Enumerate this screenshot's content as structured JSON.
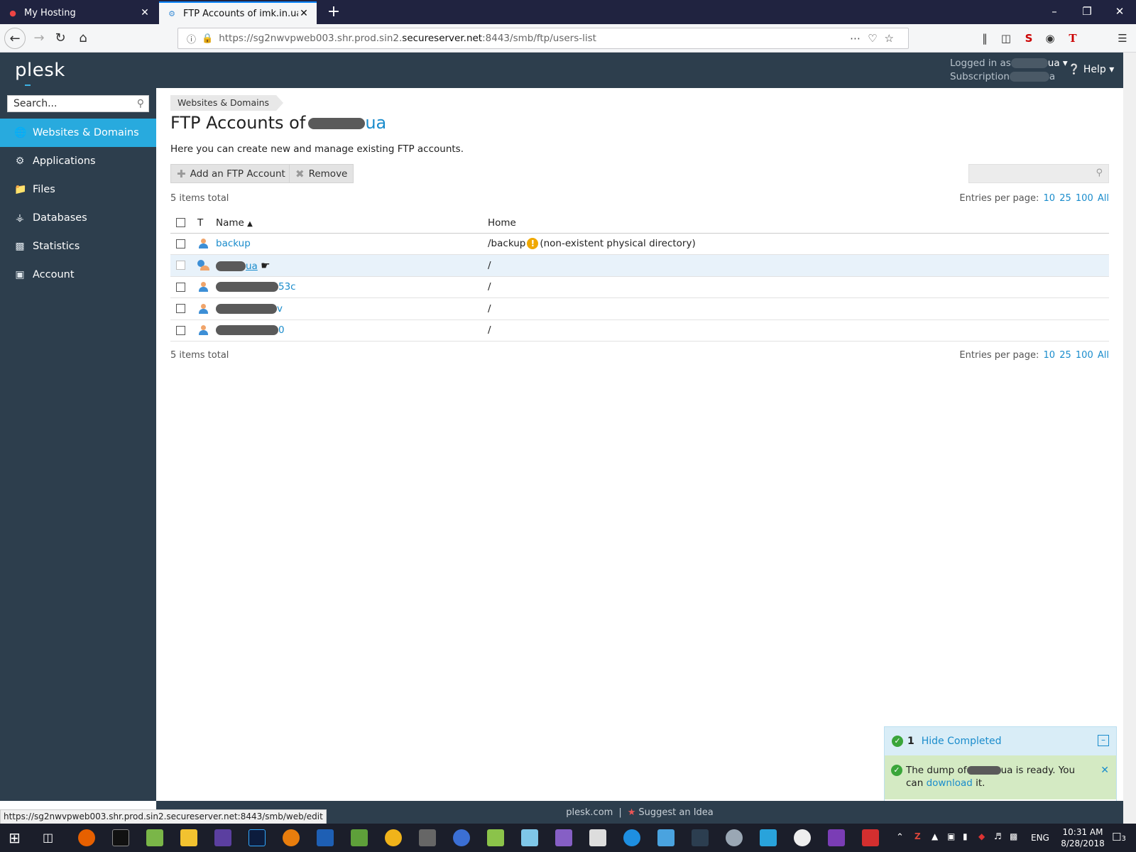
{
  "browser": {
    "tabs": [
      {
        "title": "My Hosting",
        "active": false
      },
      {
        "title": "FTP Accounts of imk.in.ua - Ple",
        "active": true
      }
    ],
    "url": {
      "prefix": "https://sg2nwvpweb003.shr.prod.sin2.",
      "domain": "secureserver.net",
      "suffix": ":8443/smb/ftp/users-list"
    },
    "status_url": "https://sg2nwvpweb003.shr.prod.sin2.secureserver.net:8443/smb/web/edit"
  },
  "header": {
    "logo": "plesk",
    "logged_in_prefix": "Logged in as",
    "logged_in_suffix": "ua",
    "subscription_prefix": "Subscription",
    "subscription_suffix": "a",
    "help_label": "Help"
  },
  "sidebar": {
    "search_placeholder": "Search...",
    "items": [
      {
        "label": "Websites & Domains",
        "icon": "globe-icon",
        "active": true
      },
      {
        "label": "Applications",
        "icon": "gear-icon",
        "active": false
      },
      {
        "label": "Files",
        "icon": "folder-icon",
        "active": false
      },
      {
        "label": "Databases",
        "icon": "database-icon",
        "active": false
      },
      {
        "label": "Statistics",
        "icon": "bar-chart-icon",
        "active": false
      },
      {
        "label": "Account",
        "icon": "account-icon",
        "active": false
      }
    ]
  },
  "main": {
    "breadcrumb": "Websites & Domains",
    "title_prefix": "FTP Accounts of",
    "title_domain_suffix": "ua",
    "hint": "Here you can create new and manage existing FTP accounts.",
    "add_button": "Add an FTP Account",
    "remove_button": "Remove",
    "total_text": "5 items total",
    "entries_label": "Entries per page:",
    "entries_options": [
      "10",
      "25",
      "100",
      "All"
    ],
    "columns": {
      "type": "T",
      "name": "Name",
      "home": "Home"
    },
    "rows": [
      {
        "name_visible": "backup",
        "home": "/backup",
        "warning": "(non-existent physical directory)",
        "icon": "user-icon"
      },
      {
        "name_visible": "ua",
        "home": "/",
        "warning": "",
        "icon": "globe-user-icon"
      },
      {
        "name_visible": "53c",
        "home": "/",
        "warning": "",
        "icon": "user-icon"
      },
      {
        "name_visible": "v",
        "home": "/",
        "warning": "",
        "icon": "user-icon"
      },
      {
        "name_visible": "0",
        "home": "/",
        "warning": "",
        "icon": "user-icon"
      }
    ]
  },
  "footer": {
    "link1": "plesk.com",
    "separator": "|",
    "link2": "Suggest an Idea"
  },
  "notification": {
    "count": "1",
    "hide_label": "Hide Completed",
    "msg_prefix": "The dump of",
    "msg_middle": "ua is ready. You can",
    "msg_link": "download",
    "msg_suffix": "it."
  },
  "taskbar": {
    "time": "10:31 AM",
    "date": "8/28/2018",
    "lang": "ENG",
    "notif_count": "3"
  },
  "colors": {
    "sidebar_bg": "#2d3e4d",
    "active_nav": "#28aade",
    "link": "#1a8ccc"
  }
}
